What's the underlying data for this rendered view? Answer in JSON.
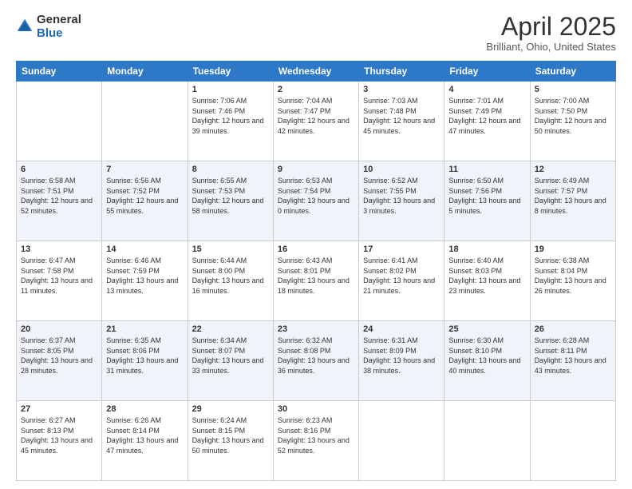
{
  "header": {
    "logo": {
      "general": "General",
      "blue": "Blue"
    },
    "title": "April 2025",
    "location": "Brilliant, Ohio, United States"
  },
  "days_of_week": [
    "Sunday",
    "Monday",
    "Tuesday",
    "Wednesday",
    "Thursday",
    "Friday",
    "Saturday"
  ],
  "weeks": [
    [
      {
        "day": "",
        "sunrise": "",
        "sunset": "",
        "daylight": ""
      },
      {
        "day": "",
        "sunrise": "",
        "sunset": "",
        "daylight": ""
      },
      {
        "day": "1",
        "sunrise": "Sunrise: 7:06 AM",
        "sunset": "Sunset: 7:46 PM",
        "daylight": "Daylight: 12 hours and 39 minutes."
      },
      {
        "day": "2",
        "sunrise": "Sunrise: 7:04 AM",
        "sunset": "Sunset: 7:47 PM",
        "daylight": "Daylight: 12 hours and 42 minutes."
      },
      {
        "day": "3",
        "sunrise": "Sunrise: 7:03 AM",
        "sunset": "Sunset: 7:48 PM",
        "daylight": "Daylight: 12 hours and 45 minutes."
      },
      {
        "day": "4",
        "sunrise": "Sunrise: 7:01 AM",
        "sunset": "Sunset: 7:49 PM",
        "daylight": "Daylight: 12 hours and 47 minutes."
      },
      {
        "day": "5",
        "sunrise": "Sunrise: 7:00 AM",
        "sunset": "Sunset: 7:50 PM",
        "daylight": "Daylight: 12 hours and 50 minutes."
      }
    ],
    [
      {
        "day": "6",
        "sunrise": "Sunrise: 6:58 AM",
        "sunset": "Sunset: 7:51 PM",
        "daylight": "Daylight: 12 hours and 52 minutes."
      },
      {
        "day": "7",
        "sunrise": "Sunrise: 6:56 AM",
        "sunset": "Sunset: 7:52 PM",
        "daylight": "Daylight: 12 hours and 55 minutes."
      },
      {
        "day": "8",
        "sunrise": "Sunrise: 6:55 AM",
        "sunset": "Sunset: 7:53 PM",
        "daylight": "Daylight: 12 hours and 58 minutes."
      },
      {
        "day": "9",
        "sunrise": "Sunrise: 6:53 AM",
        "sunset": "Sunset: 7:54 PM",
        "daylight": "Daylight: 13 hours and 0 minutes."
      },
      {
        "day": "10",
        "sunrise": "Sunrise: 6:52 AM",
        "sunset": "Sunset: 7:55 PM",
        "daylight": "Daylight: 13 hours and 3 minutes."
      },
      {
        "day": "11",
        "sunrise": "Sunrise: 6:50 AM",
        "sunset": "Sunset: 7:56 PM",
        "daylight": "Daylight: 13 hours and 5 minutes."
      },
      {
        "day": "12",
        "sunrise": "Sunrise: 6:49 AM",
        "sunset": "Sunset: 7:57 PM",
        "daylight": "Daylight: 13 hours and 8 minutes."
      }
    ],
    [
      {
        "day": "13",
        "sunrise": "Sunrise: 6:47 AM",
        "sunset": "Sunset: 7:58 PM",
        "daylight": "Daylight: 13 hours and 11 minutes."
      },
      {
        "day": "14",
        "sunrise": "Sunrise: 6:46 AM",
        "sunset": "Sunset: 7:59 PM",
        "daylight": "Daylight: 13 hours and 13 minutes."
      },
      {
        "day": "15",
        "sunrise": "Sunrise: 6:44 AM",
        "sunset": "Sunset: 8:00 PM",
        "daylight": "Daylight: 13 hours and 16 minutes."
      },
      {
        "day": "16",
        "sunrise": "Sunrise: 6:43 AM",
        "sunset": "Sunset: 8:01 PM",
        "daylight": "Daylight: 13 hours and 18 minutes."
      },
      {
        "day": "17",
        "sunrise": "Sunrise: 6:41 AM",
        "sunset": "Sunset: 8:02 PM",
        "daylight": "Daylight: 13 hours and 21 minutes."
      },
      {
        "day": "18",
        "sunrise": "Sunrise: 6:40 AM",
        "sunset": "Sunset: 8:03 PM",
        "daylight": "Daylight: 13 hours and 23 minutes."
      },
      {
        "day": "19",
        "sunrise": "Sunrise: 6:38 AM",
        "sunset": "Sunset: 8:04 PM",
        "daylight": "Daylight: 13 hours and 26 minutes."
      }
    ],
    [
      {
        "day": "20",
        "sunrise": "Sunrise: 6:37 AM",
        "sunset": "Sunset: 8:05 PM",
        "daylight": "Daylight: 13 hours and 28 minutes."
      },
      {
        "day": "21",
        "sunrise": "Sunrise: 6:35 AM",
        "sunset": "Sunset: 8:06 PM",
        "daylight": "Daylight: 13 hours and 31 minutes."
      },
      {
        "day": "22",
        "sunrise": "Sunrise: 6:34 AM",
        "sunset": "Sunset: 8:07 PM",
        "daylight": "Daylight: 13 hours and 33 minutes."
      },
      {
        "day": "23",
        "sunrise": "Sunrise: 6:32 AM",
        "sunset": "Sunset: 8:08 PM",
        "daylight": "Daylight: 13 hours and 36 minutes."
      },
      {
        "day": "24",
        "sunrise": "Sunrise: 6:31 AM",
        "sunset": "Sunset: 8:09 PM",
        "daylight": "Daylight: 13 hours and 38 minutes."
      },
      {
        "day": "25",
        "sunrise": "Sunrise: 6:30 AM",
        "sunset": "Sunset: 8:10 PM",
        "daylight": "Daylight: 13 hours and 40 minutes."
      },
      {
        "day": "26",
        "sunrise": "Sunrise: 6:28 AM",
        "sunset": "Sunset: 8:11 PM",
        "daylight": "Daylight: 13 hours and 43 minutes."
      }
    ],
    [
      {
        "day": "27",
        "sunrise": "Sunrise: 6:27 AM",
        "sunset": "Sunset: 8:13 PM",
        "daylight": "Daylight: 13 hours and 45 minutes."
      },
      {
        "day": "28",
        "sunrise": "Sunrise: 6:26 AM",
        "sunset": "Sunset: 8:14 PM",
        "daylight": "Daylight: 13 hours and 47 minutes."
      },
      {
        "day": "29",
        "sunrise": "Sunrise: 6:24 AM",
        "sunset": "Sunset: 8:15 PM",
        "daylight": "Daylight: 13 hours and 50 minutes."
      },
      {
        "day": "30",
        "sunrise": "Sunrise: 6:23 AM",
        "sunset": "Sunset: 8:16 PM",
        "daylight": "Daylight: 13 hours and 52 minutes."
      },
      {
        "day": "",
        "sunrise": "",
        "sunset": "",
        "daylight": ""
      },
      {
        "day": "",
        "sunrise": "",
        "sunset": "",
        "daylight": ""
      },
      {
        "day": "",
        "sunrise": "",
        "sunset": "",
        "daylight": ""
      }
    ]
  ]
}
